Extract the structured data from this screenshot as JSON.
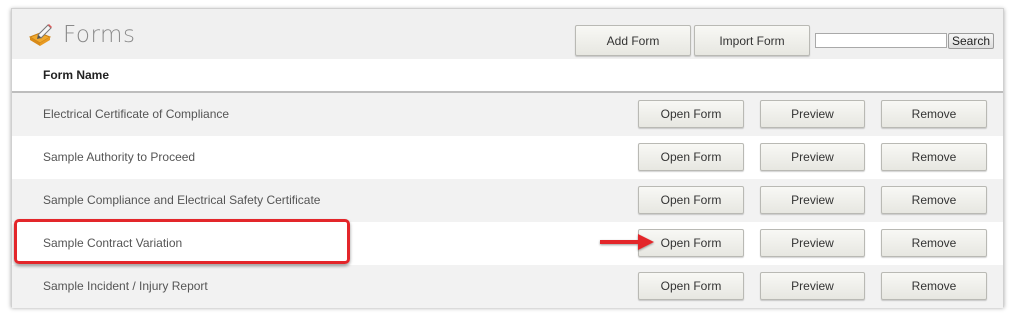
{
  "header": {
    "title": "Forms",
    "add_form_label": "Add Form",
    "import_form_label": "Import Form",
    "search_value": "",
    "search_label": "Search"
  },
  "table": {
    "column_header": "Form Name",
    "rows": [
      {
        "name": "Electrical Certificate of Compliance",
        "open": "Open Form",
        "preview": "Preview",
        "remove": "Remove"
      },
      {
        "name": "Sample Authority to Proceed",
        "open": "Open Form",
        "preview": "Preview",
        "remove": "Remove"
      },
      {
        "name": "Sample Compliance and Electrical Safety Certificate",
        "open": "Open Form",
        "preview": "Preview",
        "remove": "Remove"
      },
      {
        "name": "Sample Contract Variation",
        "open": "Open Form",
        "preview": "Preview",
        "remove": "Remove"
      },
      {
        "name": "Sample Incident / Injury Report",
        "open": "Open Form",
        "preview": "Preview",
        "remove": "Remove"
      }
    ]
  },
  "annotations": {
    "highlight_color": "#e3262a",
    "highlighted_row": "Sample Contract Variation",
    "arrow_icon": "red-arrow-right-icon"
  },
  "icons": {
    "title_icon": "forms-pencil-icon"
  }
}
